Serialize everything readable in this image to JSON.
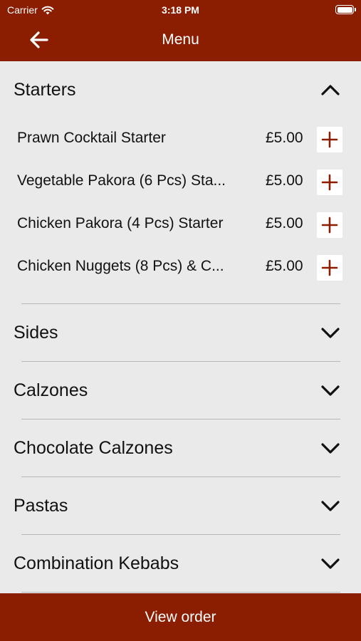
{
  "status_bar": {
    "carrier": "Carrier",
    "time": "3:18 PM"
  },
  "nav": {
    "title": "Menu",
    "back_icon": "arrow-left-icon"
  },
  "colors": {
    "brand": "#8b1d00",
    "background": "#eaeaea",
    "divider": "#b8b8b8"
  },
  "sections": [
    {
      "label": "Starters",
      "expanded": true,
      "items": [
        {
          "name": "Prawn Cocktail Starter",
          "price": "£5.00"
        },
        {
          "name": "Vegetable Pakora (6 Pcs) Sta...",
          "price": "£5.00"
        },
        {
          "name": "Chicken Pakora (4 Pcs) Starter",
          "price": "£5.00"
        },
        {
          "name": "Chicken Nuggets (8 Pcs) & C...",
          "price": "£5.00"
        }
      ]
    },
    {
      "label": "Sides",
      "expanded": false
    },
    {
      "label": "Calzones",
      "expanded": false
    },
    {
      "label": "Chocolate Calzones",
      "expanded": false
    },
    {
      "label": "Pastas",
      "expanded": false
    },
    {
      "label": "Combination Kebabs",
      "expanded": false
    }
  ],
  "footer": {
    "view_order_label": "View order"
  }
}
